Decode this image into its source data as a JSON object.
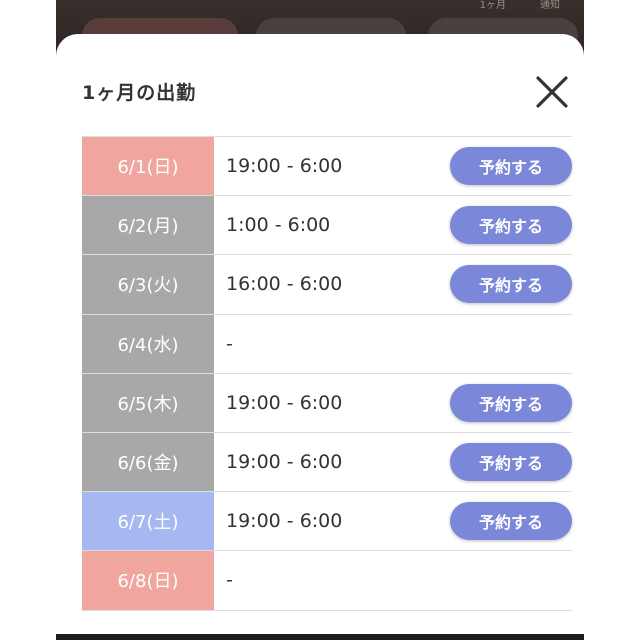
{
  "background": {
    "top_nav": [
      "1ヶ月",
      "通知"
    ]
  },
  "modal": {
    "title": "1ヶ月の出勤",
    "close_icon": "close-x-icon"
  },
  "schedule": {
    "rows": [
      {
        "date": "6/1(日)",
        "time": "19:00 - 6:00",
        "button": "予約する",
        "day_type": "sunday"
      },
      {
        "date": "6/2(月)",
        "time": "1:00 - 6:00",
        "button": "予約する",
        "day_type": "weekday"
      },
      {
        "date": "6/3(火)",
        "time": "16:00 - 6:00",
        "button": "予約する",
        "day_type": "weekday"
      },
      {
        "date": "6/4(水)",
        "time": "-",
        "button": null,
        "day_type": "weekday"
      },
      {
        "date": "6/5(木)",
        "time": "19:00 - 6:00",
        "button": "予約する",
        "day_type": "weekday"
      },
      {
        "date": "6/6(金)",
        "time": "19:00 - 6:00",
        "button": "予約する",
        "day_type": "weekday"
      },
      {
        "date": "6/7(土)",
        "time": "19:00 - 6:00",
        "button": "予約する",
        "day_type": "saturday"
      },
      {
        "date": "6/8(日)",
        "time": "-",
        "button": null,
        "day_type": "sunday"
      }
    ]
  },
  "colors": {
    "sunday": "#f1a59f",
    "saturday": "#a6b8f2",
    "weekday": "#a8a8a8",
    "button": "#7b88d9"
  }
}
